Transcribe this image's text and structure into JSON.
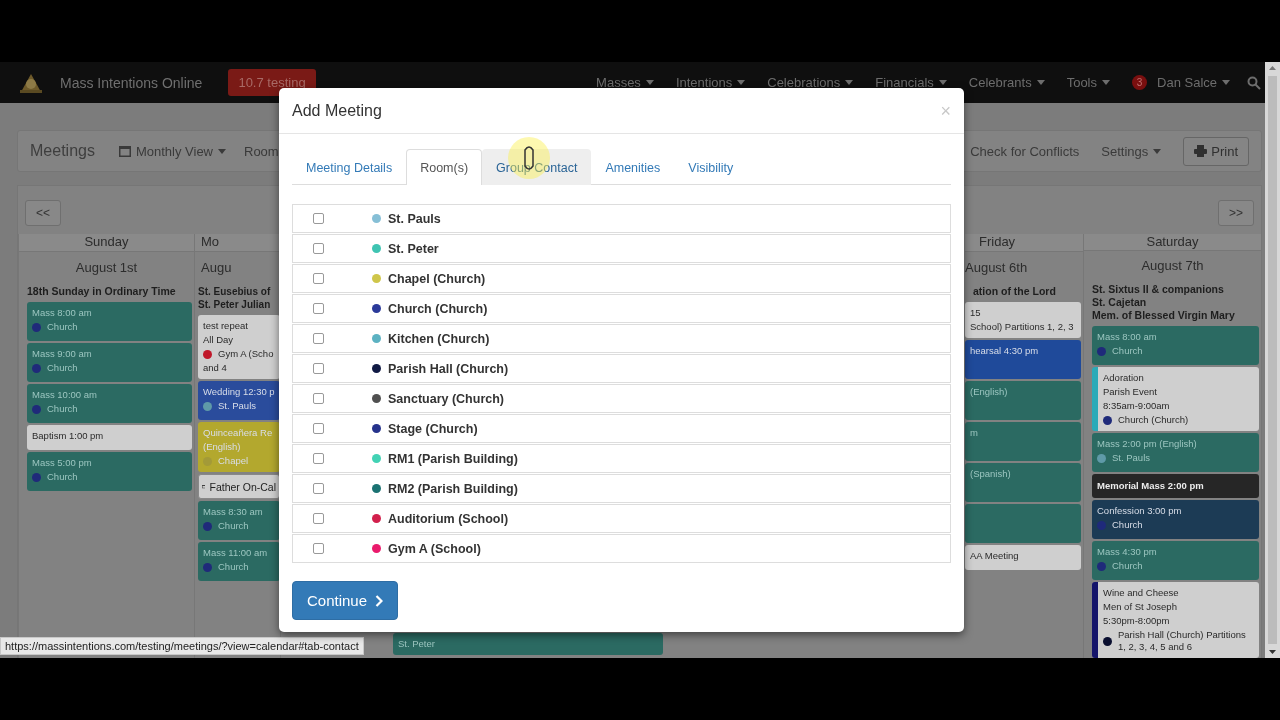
{
  "navbar": {
    "brand": "Mass Intentions Online",
    "env_badge": "10.7 testing",
    "menus": [
      {
        "label": "Masses"
      },
      {
        "label": "Intentions"
      },
      {
        "label": "Celebrations"
      },
      {
        "label": "Financials"
      },
      {
        "label": "Celebrants"
      },
      {
        "label": "Tools"
      }
    ],
    "user": {
      "badge": "3",
      "name": "Dan Salce"
    }
  },
  "toolbar": {
    "title": "Meetings",
    "view_menu": "Monthly View",
    "room_menu": "Room",
    "conflicts": "Check for Conflicts",
    "settings_menu": "Settings",
    "print": "Print"
  },
  "calendar": {
    "prev": "<<",
    "next": ">>",
    "columns": [
      {
        "kind": "day",
        "name": "Sunday",
        "date": "August 1st",
        "feast": [
          "18th Sunday in Ordinary Time"
        ],
        "events": [
          {
            "kind": "filled",
            "color": "#2b6a62",
            "lines": [
              {
                "text": "Mass 8:00 am"
              },
              {
                "text": "Church",
                "color": "#1f2a7a"
              }
            ]
          },
          {
            "kind": "filled",
            "color": "#2b6a62",
            "lines": [
              {
                "text": "Mass 9:00 am"
              },
              {
                "text": "Church",
                "color": "#1f2a7a"
              }
            ]
          },
          {
            "kind": "filled",
            "color": "#2b6a62",
            "lines": [
              {
                "text": "Mass 10:00 am"
              },
              {
                "text": "Church",
                "color": "#1f2a7a"
              }
            ]
          },
          {
            "kind": "plain",
            "color": "#cfcfcf",
            "lines": [
              {
                "text": "Baptism 1:00 pm"
              }
            ]
          },
          {
            "kind": "filled",
            "color": "#2b6a62",
            "lines": [
              {
                "text": "Mass 5:00 pm"
              },
              {
                "text": "Church",
                "color": "#1f2a7a"
              }
            ]
          }
        ]
      },
      {
        "kind": "day",
        "name": "Mo",
        "date": "Augu",
        "feast": [
          "St. Eusebius of",
          "St. Peter Julian"
        ],
        "events": [
          {
            "kind": "plain",
            "color": "#cfcfcf",
            "lines": [
              {
                "text": "test repeat"
              },
              {
                "text": "All Day"
              },
              {
                "text": "Gym A (Scho",
                "color": "#c0182a"
              },
              {
                "text": "and 4"
              }
            ]
          },
          {
            "kind": "filled",
            "color": "#2a4c9c",
            "lines": [
              {
                "text": "Wedding 12:30 p"
              },
              {
                "text": "St. Pauls",
                "color": "#5f9aa8"
              }
            ]
          },
          {
            "kind": "filled",
            "color": "#b3a82e",
            "lines": [
              {
                "text": "Quinceañera Re"
              },
              {
                "text": "(English)"
              },
              {
                "text": "Chapel",
                "color": "#a39a38"
              }
            ]
          },
          {
            "kind": "note",
            "color": "#cfcfcf",
            "lines": [
              {
                "text": "Father On-Cal"
              }
            ]
          },
          {
            "kind": "filled",
            "color": "#2b6a62",
            "lines": [
              {
                "text": "Mass 8:30 am"
              },
              {
                "text": "Church",
                "color": "#1f2a7a"
              }
            ]
          },
          {
            "kind": "filled",
            "color": "#2b6a62",
            "lines": [
              {
                "text": "Mass 11:00 am"
              },
              {
                "text": "Church",
                "color": "#1f2a7a"
              }
            ]
          }
        ]
      },
      {
        "kind": "covered",
        "events": [
          {
            "kind": "filled",
            "color": "#2b6a62",
            "lines": [
              {
                "text": "St. Peter"
              }
            ]
          }
        ]
      },
      {
        "kind": "day",
        "name": "Friday",
        "date": "August 6th",
        "feast": [
          "ation of the Lord"
        ],
        "events": [
          {
            "kind": "plain",
            "color": "#cfcfcf",
            "lines": [
              {
                "text": "15"
              },
              {
                "text": "School) Partitions 1, 2, 3"
              }
            ]
          },
          {
            "kind": "filled",
            "color": "#1f4a9a",
            "lines": [
              {
                "text": "hearsal 4:30 pm"
              }
            ]
          },
          {
            "kind": "filled",
            "color": "#2b6a62",
            "lines": [
              {
                "text": "(English)"
              }
            ]
          },
          {
            "kind": "filled",
            "color": "#2b6a62",
            "lines": [
              {
                "text": "m"
              }
            ]
          },
          {
            "kind": "filled",
            "color": "#2b6a62",
            "lines": [
              {
                "text": "(Spanish)"
              }
            ]
          },
          {
            "kind": "filled",
            "color": "#2b6a62"
          },
          {
            "kind": "plain",
            "color": "#cfcfcf",
            "lines": [
              {
                "text": "AA Meeting"
              }
            ]
          }
        ]
      },
      {
        "kind": "day",
        "name": "Saturday",
        "date": "August 7th",
        "feast": [
          "St. Sixtus II & companions",
          "St. Cajetan",
          "Mem. of Blessed Virgin Mary"
        ],
        "events": [
          {
            "kind": "filled",
            "color": "#2b6a62",
            "lines": [
              {
                "text": "Mass 8:00 am"
              },
              {
                "text": "Church",
                "color": "#1f2a7a"
              }
            ]
          },
          {
            "kind": "plain",
            "color": "#cfcfcf",
            "stripe": {
              "color": "#2aaab8"
            },
            "lines": [
              {
                "text": "Adoration"
              },
              {
                "text": "Parish Event"
              },
              {
                "text": "8:35am-9:00am"
              },
              {
                "text": "Church (Church)",
                "color": "#1f2a7a"
              }
            ]
          },
          {
            "kind": "filled",
            "color": "#2b6a62",
            "lines": [
              {
                "text": "Mass 2:00 pm (English)"
              },
              {
                "text": "St. Pauls",
                "color": "#5f9aa8"
              }
            ]
          },
          {
            "kind": "dark",
            "color": "#262626",
            "lines": [
              {
                "text": "Memorial Mass 2:00 pm"
              }
            ]
          },
          {
            "kind": "filled",
            "color": "#1c3b55",
            "lines": [
              {
                "text": "Confession 3:00 pm"
              },
              {
                "text": "Church",
                "color": "#1f2a7a"
              }
            ]
          },
          {
            "kind": "filled",
            "color": "#2b6a62",
            "lines": [
              {
                "text": "Mass 4:30 pm"
              },
              {
                "text": "Church",
                "color": "#1f2a7a"
              }
            ]
          },
          {
            "kind": "plain",
            "color": "#cfcfcf",
            "stripe": {
              "color": "#14146a"
            },
            "lines": [
              {
                "text": "Wine and Cheese"
              },
              {
                "text": "Men of St Joseph"
              },
              {
                "text": "5:30pm-8:00pm"
              },
              {
                "text": "Parish Hall (Church) Partitions 1, 2, 3, 4, 5 and 6",
                "color": "#0a0f30"
              }
            ]
          }
        ]
      }
    ]
  },
  "status_bar": {
    "url": "https://massintentions.com/testing/meetings/?view=calendar#tab-contact"
  },
  "modal": {
    "title": "Add Meeting",
    "close": "×",
    "tabs": [
      {
        "label": "Meeting Details",
        "selected": false,
        "hovered": false
      },
      {
        "label": "Room(s)",
        "selected": true,
        "hovered": false
      },
      {
        "label": "Group Contact",
        "selected": false,
        "hovered": true
      },
      {
        "label": "Amenities",
        "selected": false,
        "hovered": false
      },
      {
        "label": "Visibility",
        "selected": false,
        "hovered": false
      }
    ],
    "rooms": [
      {
        "name": "St. Pauls",
        "color": "#86bfd6",
        "checked": false
      },
      {
        "name": "St. Peter",
        "color": "#3fc4b2",
        "checked": false
      },
      {
        "name": "Chapel (Church)",
        "color": "#cfc64a",
        "checked": false
      },
      {
        "name": "Church (Church)",
        "color": "#2b3a9a",
        "checked": false
      },
      {
        "name": "Kitchen (Church)",
        "color": "#5cb2c2",
        "checked": false
      },
      {
        "name": "Parish Hall (Church)",
        "color": "#111a44",
        "checked": false
      },
      {
        "name": "Sanctuary (Church)",
        "color": "#505050",
        "checked": false
      },
      {
        "name": "Stage (Church)",
        "color": "#26338c",
        "checked": false
      },
      {
        "name": "RM1 (Parish Building)",
        "color": "#42d2b4",
        "checked": false
      },
      {
        "name": "RM2 (Parish Building)",
        "color": "#1b7272",
        "checked": false
      },
      {
        "name": "Auditorium (School)",
        "color": "#d2204c",
        "checked": false
      },
      {
        "name": "Gym A (School)",
        "color": "#ea1a6c",
        "checked": false
      }
    ],
    "continue": "Continue"
  }
}
